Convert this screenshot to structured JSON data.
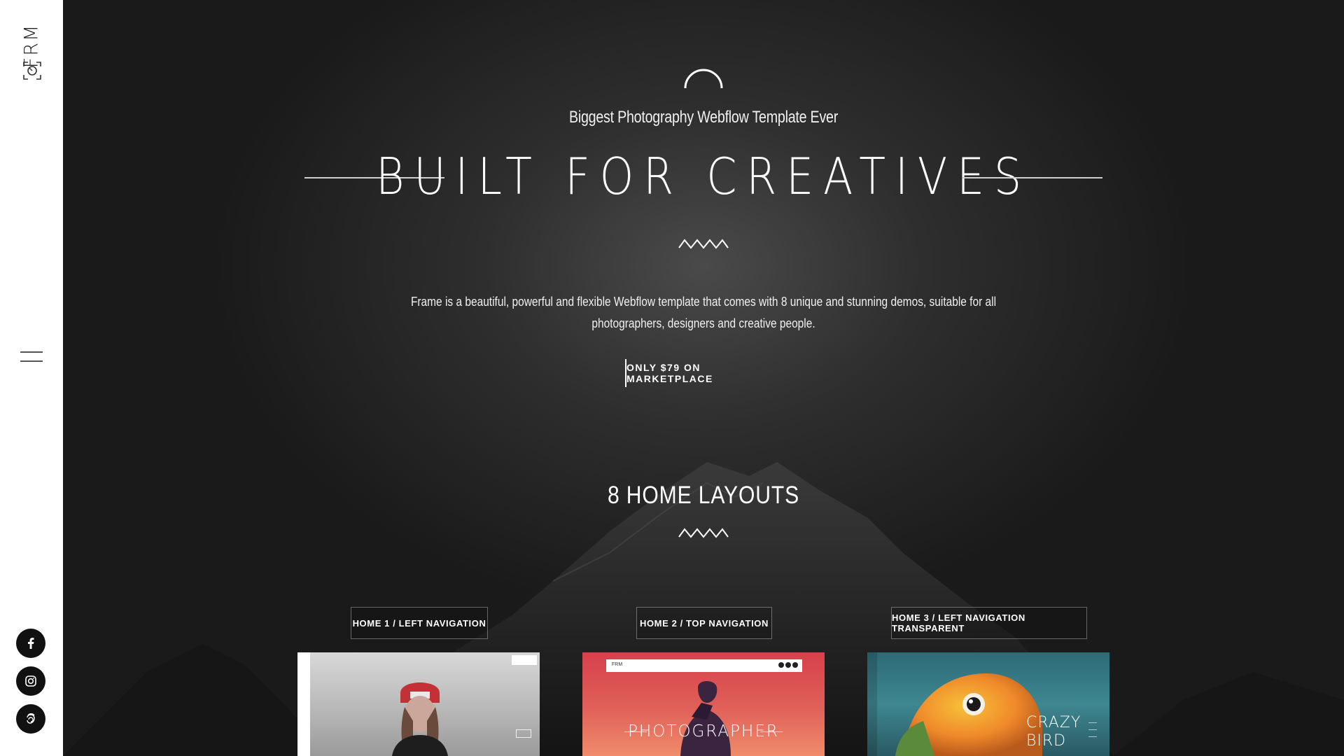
{
  "sidebar": {
    "logo_text": "FRM",
    "social": [
      {
        "name": "facebook",
        "glyph": "f"
      },
      {
        "name": "instagram",
        "glyph": "instagram-icon"
      },
      {
        "name": "dribbble-500px",
        "glyph": "500px-icon"
      }
    ]
  },
  "hero": {
    "subtitle": "Biggest Photography Webflow Template Ever",
    "title": "BUILT FOR CREATIVES",
    "description": "Frame is a beautiful, powerful and flexible Webflow template that comes with 8 unique and stunning demos, suitable for all photographers, designers and creative people.",
    "cta_label": "ONLY $79 ON MARKETPLACE"
  },
  "layouts": {
    "heading": "8 HOME LAYOUTS",
    "items": [
      {
        "label": "HOME 1 / LEFT NAVIGATION"
      },
      {
        "label": "HOME 2 / TOP NAVIGATION",
        "thumb_text": "PHOTOGRAPHER",
        "thumb_logo": "FRM"
      },
      {
        "label": "HOME 3 / LEFT NAVIGATION TRANSPARENT",
        "thumb_text_line1": "CRAZY",
        "thumb_text_line2": "BIRD"
      }
    ]
  },
  "colors": {
    "sidebar_bg": "#ffffff",
    "hero_bg": "#1a1a1a",
    "text": "#ffffff"
  }
}
